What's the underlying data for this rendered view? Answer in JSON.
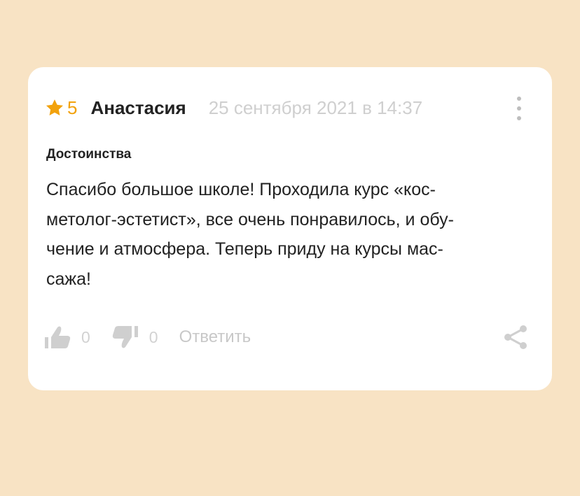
{
  "review": {
    "rating": "5",
    "author": "Анастасия",
    "date": "25 сентября 2021 в 14:37",
    "section_title": "Достоинства",
    "text_lines": [
      "Спасибо большое школе! Проходила курс «кос-",
      "метолог-эстетист», все очень понравилось, и обу-",
      "чение и атмосфера. Теперь приду на курсы мас-",
      "сажа!"
    ],
    "likes": "0",
    "dislikes": "0",
    "reply_label": "Ответить"
  },
  "icons": {
    "star": "star-icon",
    "more": "more-vertical-icon",
    "like": "thumbs-up-icon",
    "dislike": "thumbs-down-icon",
    "share": "share-icon"
  },
  "colors": {
    "background": "#f8e3c4",
    "card": "#ffffff",
    "star": "#f2a20c",
    "text": "#222222",
    "muted": "#cfcfcf"
  }
}
